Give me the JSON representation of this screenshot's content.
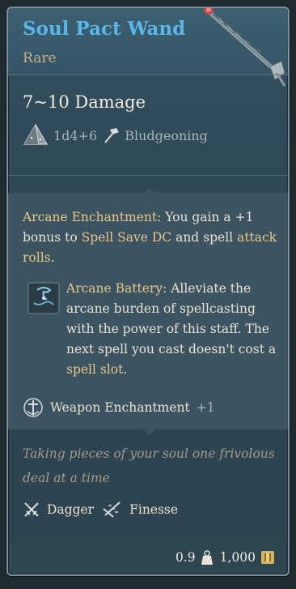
{
  "item": {
    "name": "Soul Pact Wand",
    "rarity": "Rare"
  },
  "damage": {
    "summary": "7~10 Damage",
    "dice": "1d4+6",
    "type": "Bludgeoning"
  },
  "enchantment": {
    "label": "Arcane Enchantment:",
    "text_a": " You gain a +1 bonus to ",
    "highlight_a": "Spell Save DC",
    "text_b": " and spell ",
    "highlight_b": "attack rolls",
    "text_c": "."
  },
  "battery": {
    "label": "Arcane Battery:",
    "text_a": " Alleviate the arcane burden of spellcasting with the power of this staff. The next spell you cast doesn't cost a ",
    "highlight": "spell slot",
    "text_b": "."
  },
  "weapon_enchantment": {
    "label": "Weapon Enchantment",
    "bonus": "+1"
  },
  "flavor": "Taking pieces of your soul one frivolous deal at a time",
  "properties": [
    {
      "label": "Dagger",
      "icon": "crossed-daggers-icon"
    },
    {
      "label": "Finesse",
      "icon": "finesse-icon"
    }
  ],
  "footer": {
    "weight": "0.9",
    "value": "1,000"
  },
  "colors": {
    "name": "#5bb6ea",
    "rarity": "#c9ad87",
    "highlight": "#e6c787",
    "flavor": "#a49a8c"
  }
}
